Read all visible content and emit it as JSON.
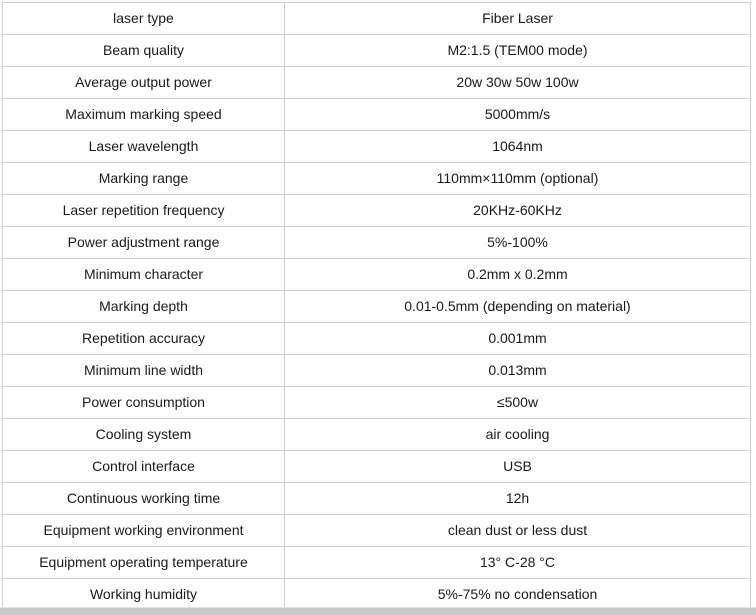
{
  "spec_table": {
    "rows": [
      {
        "label": "laser type",
        "value": "Fiber Laser"
      },
      {
        "label": "Beam quality",
        "value": "M2:1.5 (TEM00 mode)"
      },
      {
        "label": "Average output power",
        "value": "20w 30w 50w 100w"
      },
      {
        "label": "Maximum marking speed",
        "value": "5000mm/s"
      },
      {
        "label": "Laser wavelength",
        "value": "1064nm"
      },
      {
        "label": "Marking range",
        "value": "110mm×110mm (optional)"
      },
      {
        "label": "Laser repetition frequency",
        "value": "20KHz-60KHz"
      },
      {
        "label": "Power adjustment range",
        "value": "5%-100%"
      },
      {
        "label": "Minimum character",
        "value": "0.2mm x 0.2mm"
      },
      {
        "label": "Marking depth",
        "value": "0.01-0.5mm (depending on material)"
      },
      {
        "label": "Repetition accuracy",
        "value": "0.001mm"
      },
      {
        "label": "Minimum line width",
        "value": "0.013mm"
      },
      {
        "label": "Power consumption",
        "value": "≤500w"
      },
      {
        "label": "Cooling system",
        "value": "air cooling"
      },
      {
        "label": "Control interface",
        "value": "USB"
      },
      {
        "label": "Continuous working time",
        "value": "12h"
      },
      {
        "label": "Equipment working environment",
        "value": "clean dust or less dust"
      },
      {
        "label": "Equipment operating temperature",
        "value": "13° C-28 °C"
      },
      {
        "label": "Working humidity",
        "value": "5%-75% no condensation"
      }
    ]
  }
}
